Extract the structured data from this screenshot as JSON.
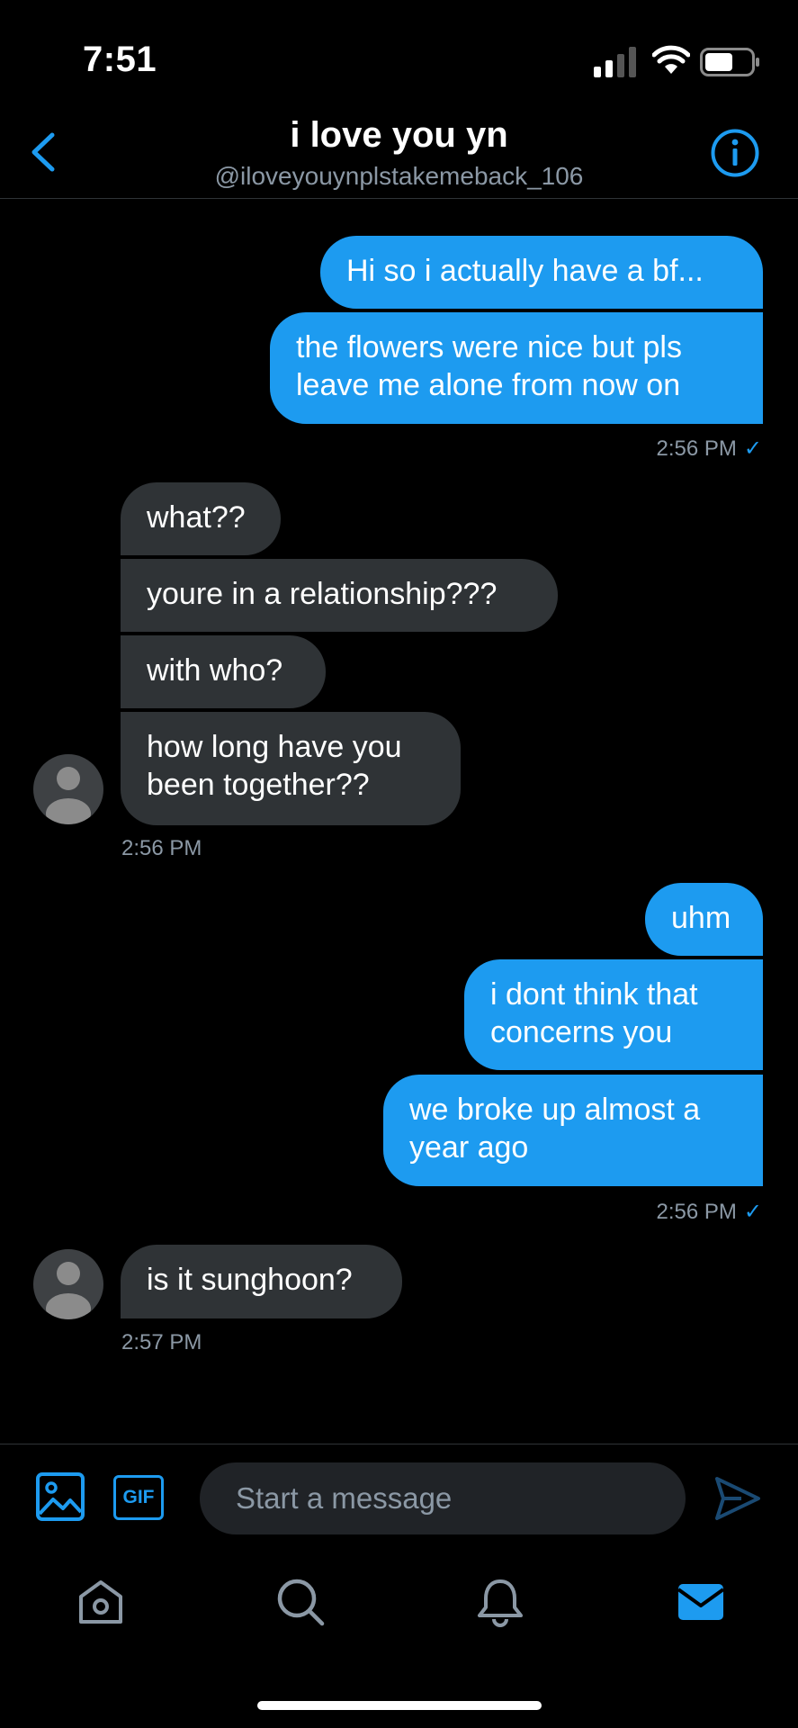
{
  "status_bar": {
    "time": "7:51"
  },
  "header": {
    "title": "i love you yn",
    "handle": "@iloveyouynplstakemeback_106"
  },
  "messages": [
    {
      "dir": "out",
      "text": "Hi so i actually have a bf..."
    },
    {
      "dir": "out",
      "text": "the flowers were nice but pls\nleave me alone from now on"
    },
    {
      "dir": "in",
      "text": "what??"
    },
    {
      "dir": "in",
      "text": "youre in a relationship???"
    },
    {
      "dir": "in",
      "text": "with who?"
    },
    {
      "dir": "in",
      "text": "how long have you\nbeen together??"
    },
    {
      "dir": "out",
      "text": "uhm"
    },
    {
      "dir": "out",
      "text": "i dont think that\nconcerns you"
    },
    {
      "dir": "out",
      "text": "we broke up almost a\nyear ago"
    },
    {
      "dir": "in",
      "text": "is it sunghoon?"
    }
  ],
  "timestamps": [
    "2:56 PM",
    "2:56 PM",
    "2:56 PM",
    "2:57 PM"
  ],
  "read_mark": "✓",
  "composer": {
    "placeholder": "Start a message",
    "gif_label": "GIF"
  },
  "colors": {
    "accent": "#1d9bf0",
    "incoming_bubble": "#2f3336",
    "background": "#000000",
    "muted_text": "#8b98a5"
  },
  "icons": [
    "back-chevron-icon",
    "info-icon",
    "media-icon",
    "gif-icon",
    "send-icon",
    "home-icon",
    "search-icon",
    "bell-icon",
    "mail-icon"
  ],
  "tab_bar": {
    "active": "messages"
  }
}
